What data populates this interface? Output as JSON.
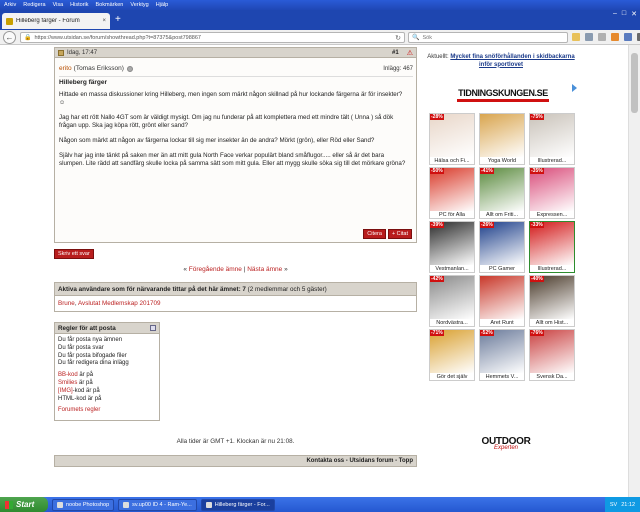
{
  "menubar": [
    "Arkiv",
    "Redigera",
    "Visa",
    "Historik",
    "Bokmärken",
    "Verktyg",
    "Hjälp"
  ],
  "browser": {
    "tab_title": "Hilleberg färger - Forum",
    "url": "https://www.utsidan.se/forum/showthread.php?t=87375&post798867",
    "search_placeholder": "Sök"
  },
  "post": {
    "date": "Idag, 17:47",
    "number": "#1",
    "author": "erito",
    "author_real": "(Tomas Eriksson)",
    "posts_count": "Inlägg: 467",
    "title": "Hilleberg färger",
    "paragraphs": [
      "Hittade en massa diskussioner kring Hilleberg, men ingen som märkt någon skillnad på hur lockande färgerna är för insekter? ☺",
      "Jag har ett rött Nallo 4GT som är väldigt mysigt. Om jag nu funderar på att komplettera med ett mindre tält ( Unna ) så dök frågan upp. Ska jag köpa rött, grönt eller sand?",
      "Någon som märkt att någon av färgerna lockar till sig mer insekter än de andra? Mörkt (grön), eller Röd eller Sand?",
      "Själv har jag inte tänkt på saken mer än att mitt gula North Face verkar populärt bland småflugor..... eller så är det bara slumpen. Lite rädd att sandfärg skulle locka på samma sätt som mitt gula. Eller att mygg skulle söka sig till det mörkare gröna?"
    ],
    "quote_label": "Citera",
    "multiquote_label": "+ Citat"
  },
  "reply_label": "Skriv ett svar",
  "thread_nav": {
    "prev": "Föregående ämne",
    "separator": "|",
    "next": "Nästa ämne",
    "left_arrow": "«",
    "right_arrow": "»"
  },
  "active": {
    "heading": "Aktiva användare som för närvarande tittar på det här ämnet: 7",
    "detail": "(2 medlemmar och 5 gäster)",
    "users": [
      "Brune",
      "Avslutat Medlemskap 201709"
    ]
  },
  "rules": {
    "heading": "Regler för att posta",
    "lines": [
      "Du får posta nya ämnen",
      "Du får posta svar",
      "Du får posta bifogade filer",
      "Du får redigera dina inlägg"
    ],
    "codes": [
      {
        "label": "BB-kod",
        "state": "är på"
      },
      {
        "label": "Smilies",
        "state": "är på"
      },
      {
        "label": "[IMG]",
        "state": "-kod är på"
      },
      {
        "label": "HTML-kod",
        "state": "är på"
      }
    ],
    "forum_rules": "Forumets regler"
  },
  "timezone": "Alla tider är GMT +1. Klockan är nu 21:08.",
  "footer": "Kontakta oss - Utsidans forum - Topp",
  "news": {
    "label": "Aktuellt:",
    "link": "Mycket fina snöförhållanden i skidbackarna inför sportlovet"
  },
  "ad": {
    "logo": "TIDNINGSKUNGEN.SE",
    "magazines": [
      {
        "name": "Hälsa och Fi...",
        "pct": "-28%",
        "color": "#e8d6c8"
      },
      {
        "name": "Yoga World",
        "pct": "",
        "color": "#d9a54f"
      },
      {
        "name": "Illustrerad...",
        "pct": "-75%",
        "color": "#c9c2b9"
      },
      {
        "name": "PC för Alla",
        "pct": "-50%",
        "color": "#d93a2a"
      },
      {
        "name": "Allt om Friti...",
        "pct": "-41%",
        "color": "#5a8a3d"
      },
      {
        "name": "Expressen...",
        "pct": "-35%",
        "color": "#d94c7a"
      },
      {
        "name": "Vestmanlan...",
        "pct": "-39%",
        "color": "#2b2b2b"
      },
      {
        "name": "PC Gamer",
        "pct": "-26%",
        "color": "#1d3f8a"
      },
      {
        "name": "Illustrerad...",
        "pct": "-33%",
        "color": "#d21818"
      },
      {
        "name": "Nordvästra...",
        "pct": "-42%",
        "color": "#8a8a8a"
      },
      {
        "name": "Året Runt",
        "pct": "",
        "color": "#c8382a"
      },
      {
        "name": "Allt om Hist...",
        "pct": "-40%",
        "color": "#4a3a2a"
      },
      {
        "name": "Gör det själv",
        "pct": "-71%",
        "color": "#d9a030"
      },
      {
        "name": "Hemmets V...",
        "pct": "-52%",
        "color": "#6a7a9a"
      },
      {
        "name": "Svensk Da...",
        "pct": "-76%",
        "color": "#c94040"
      }
    ],
    "brand_line1": "OUTDOOR",
    "brand_line2": "Experten"
  },
  "taskbar": {
    "start": "Start",
    "tasks": [
      "noobe Photoshop",
      "sv.up00 ID 4 - Ram-Ye...",
      "Hilleberg färger - For..."
    ],
    "lang": "SV",
    "clock": "21:12"
  }
}
